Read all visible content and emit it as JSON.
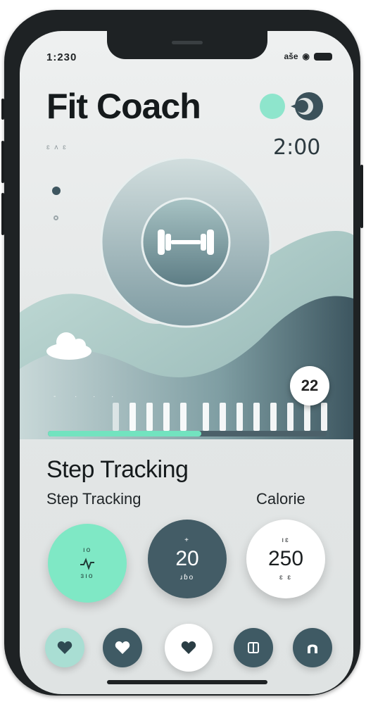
{
  "status_bar": {
    "time": "1:230",
    "carrier": "aše"
  },
  "header": {
    "title": "Fit Coach",
    "timer": "2:00",
    "side_label": "ɛ ʌ ɛ"
  },
  "hero": {
    "icon": "dumbbell-icon",
    "badge_value": "22",
    "progress_fraction": 0.55,
    "tick_labels": [
      "-",
      "·",
      "·",
      "·"
    ]
  },
  "section": {
    "title": "Step Tracking",
    "subtitle_left": "Step Tracking",
    "subtitle_right": "Calorie"
  },
  "stats": [
    {
      "top": "ıo",
      "value": "",
      "bottom": "ɜıo",
      "icon": "heartbeat-icon",
      "bg": "#7fe8c5"
    },
    {
      "top": "+",
      "value": "20",
      "bottom": "ɹɓo",
      "bg": "#435c66"
    },
    {
      "top": "ıɛ",
      "value": "250",
      "bottom": "ɛ ɛ",
      "bg": "#ffffff"
    }
  ],
  "nav": [
    {
      "icon": "heart-icon",
      "bg": "#a9ded3"
    },
    {
      "icon": "heart-icon",
      "bg": "#3f5a64"
    },
    {
      "icon": "heart-icon",
      "bg": "#ffffff"
    },
    {
      "icon": "journal-icon",
      "bg": "#3f5a64"
    },
    {
      "icon": "arch-icon",
      "bg": "#3f5a64"
    }
  ],
  "colors": {
    "accent": "#72e3bf",
    "dark": "#3f5a64",
    "bg": "#e6e9e9"
  }
}
